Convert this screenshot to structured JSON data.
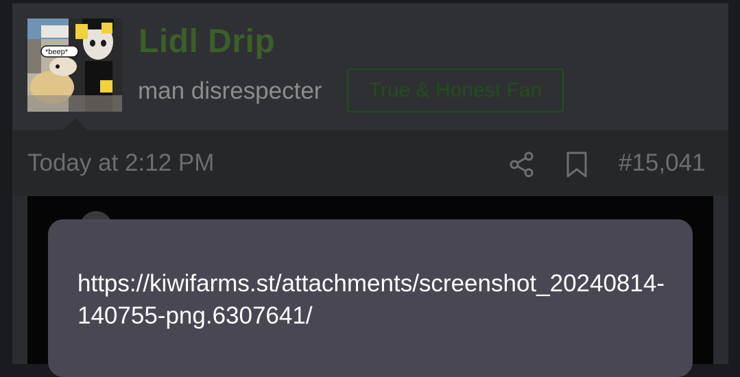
{
  "post": {
    "user": {
      "avatar_icon": "avatar-image",
      "avatar_caption": "*beep*",
      "username": "Lidl Drip",
      "title": "man disrespecter",
      "badge": "True & Honest Fan"
    },
    "meta": {
      "timestamp": "Today at 2:12 PM",
      "share_icon": "share-icon",
      "bookmark_icon": "bookmark-icon",
      "post_number": "#15,041"
    }
  },
  "link_preview": {
    "url": "https://kiwifarms.st/attachments/screenshot_20240814-140755-png.6307641/"
  },
  "colors": {
    "username": "#3b5f28",
    "badge": "#1f4f1c",
    "popup_bg": "#4a4755"
  }
}
